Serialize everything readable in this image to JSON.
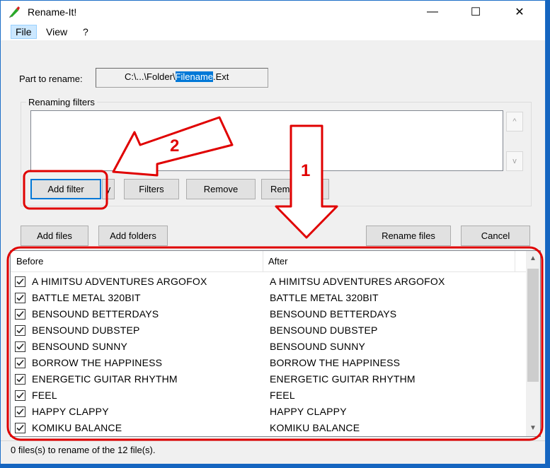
{
  "window": {
    "title": "Rename-It!"
  },
  "titlebar": {
    "minimize": "—",
    "maximize": "☐",
    "close": "✕"
  },
  "menu": [
    "File",
    "View",
    "?"
  ],
  "part_to_rename": {
    "label": "Part to rename:",
    "prefix": "C:\\...\\Folder\\",
    "highlight": "Filename",
    "suffix": ".Ext"
  },
  "filters": {
    "group_label": "Renaming filters",
    "scroll_up": "^",
    "scroll_down": "v",
    "buttons": {
      "add_filter": "Add filter",
      "edit_fragment": "y",
      "filters": "Filters",
      "remove": "Remove",
      "remove_all": "Rem"
    }
  },
  "actions": {
    "add_files": "Add files",
    "add_folders": "Add folders",
    "rename_files": "Rename files",
    "cancel": "Cancel"
  },
  "file_list": {
    "columns": [
      "Before",
      "After"
    ],
    "rows": [
      {
        "before": "A HIMITSU ADVENTURES ARGOFOX",
        "after": "A HIMITSU ADVENTURES ARGOFOX",
        "checked": true
      },
      {
        "before": "BATTLE METAL 320BIT",
        "after": "BATTLE METAL 320BIT",
        "checked": true
      },
      {
        "before": "BENSOUND BETTERDAYS",
        "after": "BENSOUND BETTERDAYS",
        "checked": true
      },
      {
        "before": "BENSOUND DUBSTEP",
        "after": "BENSOUND DUBSTEP",
        "checked": true
      },
      {
        "before": "BENSOUND SUNNY",
        "after": "BENSOUND SUNNY",
        "checked": true
      },
      {
        "before": "BORROW THE HAPPINESS",
        "after": "BORROW THE HAPPINESS",
        "checked": true
      },
      {
        "before": "ENERGETIC GUITAR RHYTHM",
        "after": "ENERGETIC GUITAR RHYTHM",
        "checked": true
      },
      {
        "before": "FEEL",
        "after": "FEEL",
        "checked": true
      },
      {
        "before": "HAPPY CLAPPY",
        "after": "HAPPY CLAPPY",
        "checked": true
      },
      {
        "before": "KOMIKU BALANCE",
        "after": "KOMIKU BALANCE",
        "checked": true
      }
    ]
  },
  "status": {
    "text": "0 files(s) to rename of the 12 file(s)."
  },
  "annotations": {
    "callout_1": "1",
    "callout_2": "2",
    "color": "#e00000"
  }
}
